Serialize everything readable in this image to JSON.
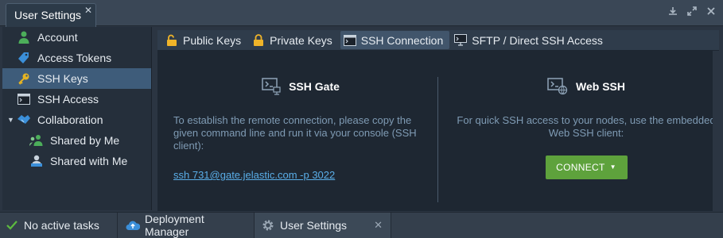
{
  "window": {
    "tab_title": "User Settings",
    "close_glyph": "✕",
    "controls": [
      "download-icon",
      "expand-icon",
      "close-icon"
    ]
  },
  "sidebar": {
    "items": [
      {
        "label": "Account",
        "icon": "account-icon"
      },
      {
        "label": "Access Tokens",
        "icon": "tag-icon"
      },
      {
        "label": "SSH Keys",
        "icon": "key-icon",
        "active": true
      },
      {
        "label": "SSH Access",
        "icon": "terminal-icon"
      },
      {
        "label": "Collaboration",
        "icon": "handshake-icon",
        "expanded": true
      },
      {
        "label": "Shared by Me",
        "icon": "users-share-icon"
      },
      {
        "label": "Shared with Me",
        "icon": "user-share-icon"
      }
    ]
  },
  "subtabs": [
    {
      "label": "Public Keys",
      "icon": "lock-open-icon"
    },
    {
      "label": "Private Keys",
      "icon": "lock-icon"
    },
    {
      "label": "SSH Connection",
      "icon": "terminal-icon",
      "active": true
    },
    {
      "label": "SFTP / Direct SSH Access",
      "icon": "monitor-icon"
    }
  ],
  "ssh_gate": {
    "title": "SSH Gate",
    "description": "To establish the remote connection, please copy the given command line and run it via your console (SSH client):",
    "command": "ssh 731@gate.jelastic.com -p 3022"
  },
  "web_ssh": {
    "title": "Web SSH",
    "description": "For quick SSH access to your nodes, use the embedded Web SSH client:",
    "button": "CONNECT"
  },
  "taskbar": {
    "items": [
      {
        "label": "No active tasks",
        "icon": "check-icon"
      },
      {
        "label": "Deployment Manager",
        "icon": "cloud-upload-icon"
      },
      {
        "label": "User Settings",
        "icon": "gear-icon",
        "current": true
      }
    ]
  },
  "colors": {
    "accent_blue": "#3e5c7a",
    "link": "#5aaee8",
    "connect_green": "#5ea23c",
    "check_green": "#5dbb3f",
    "lock_gold": "#f0b429"
  }
}
